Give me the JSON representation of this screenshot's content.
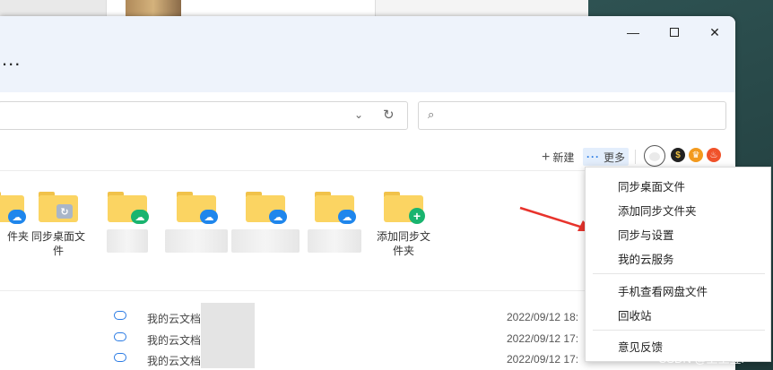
{
  "window": {
    "title_dots": "...",
    "minimize_glyph": "—",
    "close_glyph": "✕"
  },
  "toolbar": {
    "path_chevron": "⌄",
    "refresh_glyph": "↻",
    "search_glyph": "⌕",
    "search_placeholder": ""
  },
  "actions": {
    "new_label": "新建",
    "new_glyph": "+",
    "more_label": "更多",
    "more_glyph": "···",
    "badge_1": "$",
    "badge_2": "♛",
    "badge_3": "♨"
  },
  "folders": [
    {
      "label": "件夹",
      "sync": "blue"
    },
    {
      "label": "同步桌面文件",
      "sync": "gray"
    },
    {
      "label": "",
      "sync": "green"
    },
    {
      "label": "",
      "sync": "blue"
    },
    {
      "label": "",
      "sync": "blue"
    },
    {
      "label": "",
      "sync": "blue"
    },
    {
      "label": "添加同步文件夹",
      "sync": "plus"
    }
  ],
  "files": [
    {
      "name": "我的云文档",
      "date": "2022/09/12 18:"
    },
    {
      "name": "我的云文档",
      "date": "2022/09/12 17:"
    },
    {
      "name": "我的云文档",
      "date": "2022/09/12 17:"
    }
  ],
  "menu": {
    "items": [
      "同步桌面文件",
      "添加同步文件夹",
      "同步与设置",
      "我的云服务",
      "手机查看网盘文件",
      "回收站",
      "意见反馈"
    ]
  },
  "watermark": "CSDN @上上签i",
  "colors": {
    "accent": "#2a7be4",
    "arrow": "#e8332c",
    "folder": "#fbd462"
  }
}
